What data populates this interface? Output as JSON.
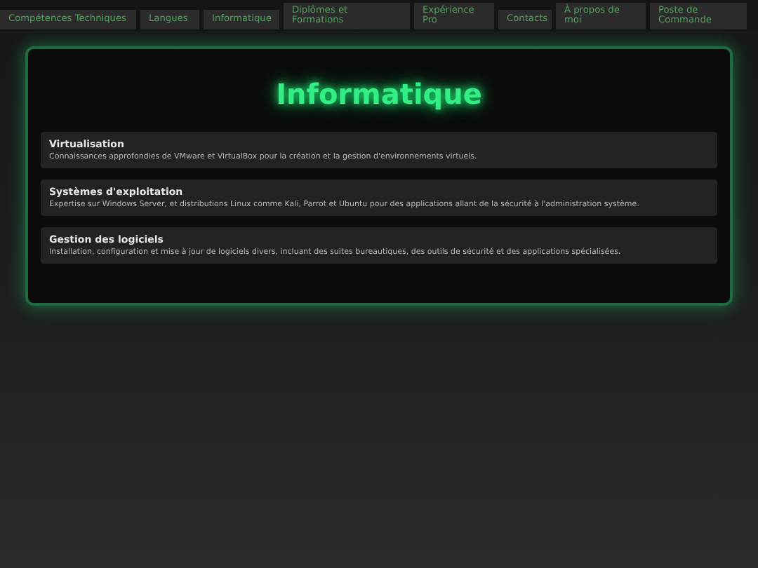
{
  "nav": {
    "items": [
      {
        "label": "Compétences Techniques"
      },
      {
        "label": "Langues"
      },
      {
        "label": "Informatique"
      },
      {
        "label": "Diplômes et Formations"
      },
      {
        "label": "Expérience Pro"
      },
      {
        "label": "Contacts"
      },
      {
        "label": "À propos de moi"
      },
      {
        "label": "Poste de Commande"
      }
    ]
  },
  "section": {
    "title": "Informatique",
    "items": [
      {
        "title": "Virtualisation",
        "text": "Connaissances approfondies de VMware et VirtualBox pour la création et la gestion d'environnements virtuels."
      },
      {
        "title": "Systèmes d'exploitation",
        "text": "Expertise sur Windows Server, et distributions Linux comme Kali, Parrot et Ubuntu pour des applications allant de la sécurité à l'administration système."
      },
      {
        "title": "Gestion des logiciels",
        "text": "Installation, configuration et mise à jour de logiciels divers, incluant des suites bureautiques, des outils de sécurité et des applications spécialisées."
      }
    ]
  }
}
